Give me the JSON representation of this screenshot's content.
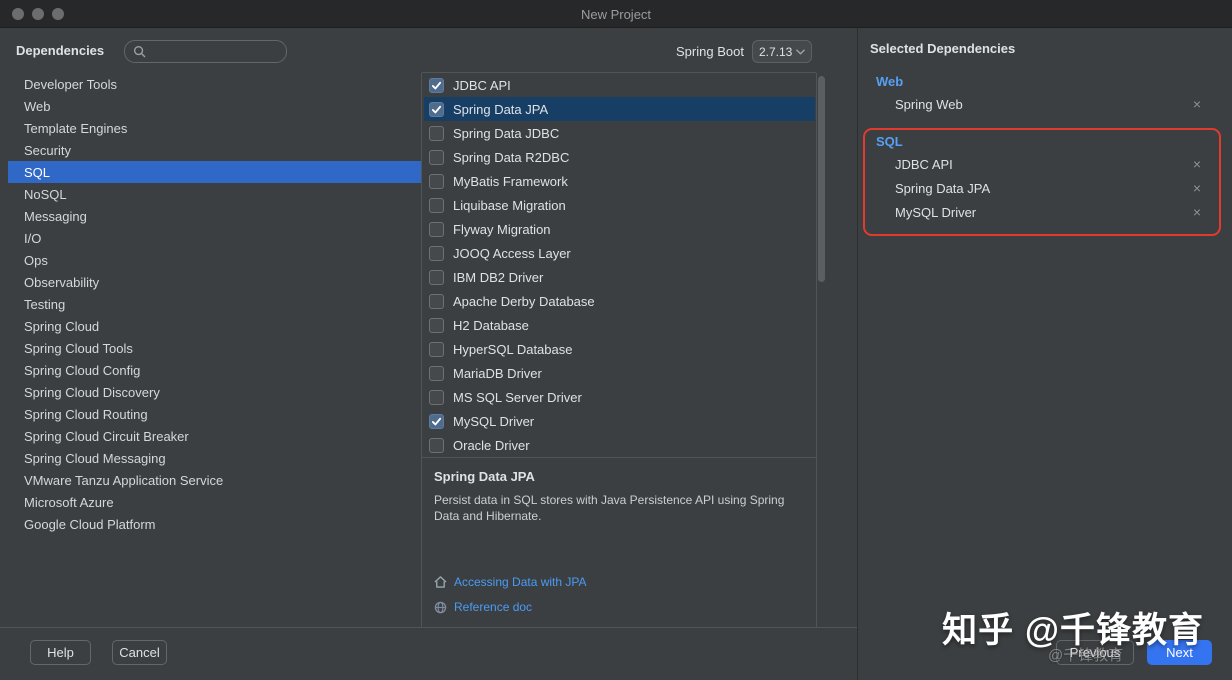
{
  "titlebar": {
    "title": "New Project"
  },
  "header": {
    "dependencies_label": "Dependencies",
    "search_value": "",
    "search_placeholder": "",
    "spring_boot_label": "Spring Boot",
    "spring_boot_version": "2.7.13"
  },
  "categories": [
    {
      "label": "Developer Tools",
      "selected": false
    },
    {
      "label": "Web",
      "selected": false
    },
    {
      "label": "Template Engines",
      "selected": false
    },
    {
      "label": "Security",
      "selected": false
    },
    {
      "label": "SQL",
      "selected": true
    },
    {
      "label": "NoSQL",
      "selected": false
    },
    {
      "label": "Messaging",
      "selected": false
    },
    {
      "label": "I/O",
      "selected": false
    },
    {
      "label": "Ops",
      "selected": false
    },
    {
      "label": "Observability",
      "selected": false
    },
    {
      "label": "Testing",
      "selected": false
    },
    {
      "label": "Spring Cloud",
      "selected": false
    },
    {
      "label": "Spring Cloud Tools",
      "selected": false
    },
    {
      "label": "Spring Cloud Config",
      "selected": false
    },
    {
      "label": "Spring Cloud Discovery",
      "selected": false
    },
    {
      "label": "Spring Cloud Routing",
      "selected": false
    },
    {
      "label": "Spring Cloud Circuit Breaker",
      "selected": false
    },
    {
      "label": "Spring Cloud Messaging",
      "selected": false
    },
    {
      "label": "VMware Tanzu Application Service",
      "selected": false
    },
    {
      "label": "Microsoft Azure",
      "selected": false
    },
    {
      "label": "Google Cloud Platform",
      "selected": false
    }
  ],
  "dependency_list": [
    {
      "label": "JDBC API",
      "checked": true,
      "highlighted": false
    },
    {
      "label": "Spring Data JPA",
      "checked": true,
      "highlighted": true
    },
    {
      "label": "Spring Data JDBC",
      "checked": false,
      "highlighted": false
    },
    {
      "label": "Spring Data R2DBC",
      "checked": false,
      "highlighted": false
    },
    {
      "label": "MyBatis Framework",
      "checked": false,
      "highlighted": false
    },
    {
      "label": "Liquibase Migration",
      "checked": false,
      "highlighted": false
    },
    {
      "label": "Flyway Migration",
      "checked": false,
      "highlighted": false
    },
    {
      "label": "JOOQ Access Layer",
      "checked": false,
      "highlighted": false
    },
    {
      "label": "IBM DB2 Driver",
      "checked": false,
      "highlighted": false
    },
    {
      "label": "Apache Derby Database",
      "checked": false,
      "highlighted": false
    },
    {
      "label": "H2 Database",
      "checked": false,
      "highlighted": false
    },
    {
      "label": "HyperSQL Database",
      "checked": false,
      "highlighted": false
    },
    {
      "label": "MariaDB Driver",
      "checked": false,
      "highlighted": false
    },
    {
      "label": "MS SQL Server Driver",
      "checked": false,
      "highlighted": false
    },
    {
      "label": "MySQL Driver",
      "checked": true,
      "highlighted": false
    },
    {
      "label": "Oracle Driver",
      "checked": false,
      "highlighted": false
    }
  ],
  "detail": {
    "title": "Spring Data JPA",
    "description": "Persist data in SQL stores with Java Persistence API using Spring Data and Hibernate.",
    "links": [
      {
        "label": "Accessing Data with JPA",
        "icon": "home-icon"
      },
      {
        "label": "Reference doc",
        "icon": "doc-icon"
      }
    ]
  },
  "selected_dependencies": {
    "title": "Selected Dependencies",
    "remove_glyph": "×",
    "groups": [
      {
        "name": "Web",
        "items": [
          "Spring Web"
        ],
        "annotated": false
      },
      {
        "name": "SQL",
        "items": [
          "JDBC API",
          "Spring Data JPA",
          "MySQL Driver"
        ],
        "annotated": true
      }
    ]
  },
  "footer": {
    "help": "Help",
    "cancel": "Cancel",
    "previous": "Previous",
    "next": "Next"
  },
  "watermark": {
    "main": "知乎 @千锋教育",
    "faint": "@千锋教育"
  },
  "colors": {
    "background": "#3c3f41",
    "titlebar": "#262829",
    "category_selection_blue": "#3068c8",
    "row_highlight_blue": "#173f66",
    "checkbox_checked": "#4f6c8c",
    "accent_blue": "#3574f0",
    "link_blue": "#4a9bf5",
    "group_label_blue": "#56a0f5",
    "annotation_red": "#e23b2e"
  }
}
